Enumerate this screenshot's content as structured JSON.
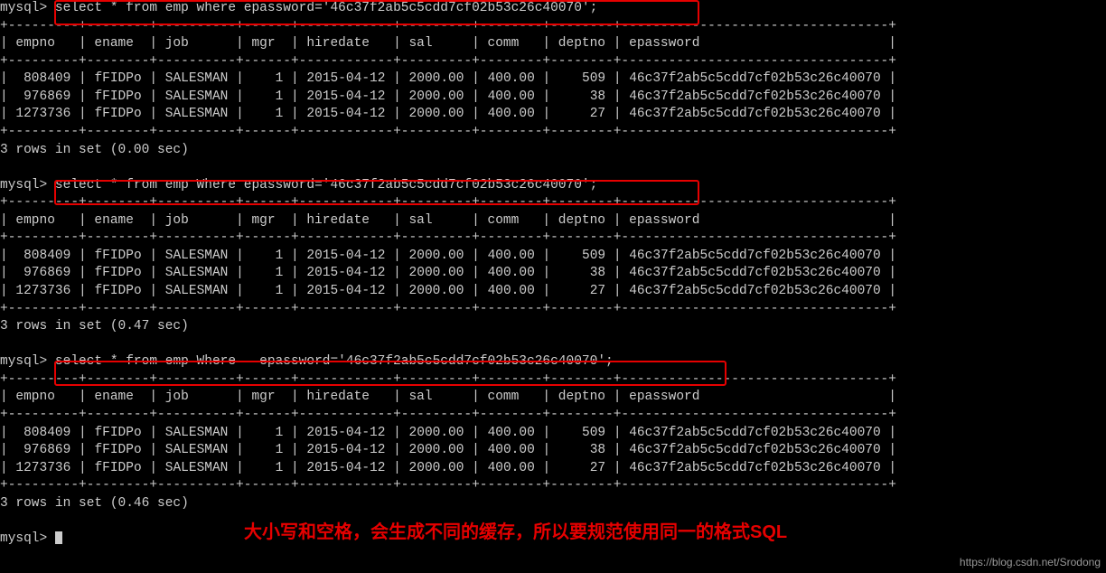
{
  "prompt": "mysql>",
  "queries": [
    "select * from emp where epassword='46c37f2ab5c5cdd7cf02b53c26c40070';",
    "select * from emp Where epassword='46c37f2ab5c5cdd7cf02b53c26c40070';",
    "select * from emp Where   epassword='46c37f2ab5c5cdd7cf02b53c26c40070';"
  ],
  "headers": [
    "empno",
    "ename",
    "job",
    "mgr",
    "hiredate",
    "sal",
    "comm",
    "deptno",
    "epassword"
  ],
  "rows": [
    {
      "empno": "808409",
      "ename": "fFIDPo",
      "job": "SALESMAN",
      "mgr": "1",
      "hiredate": "2015-04-12",
      "sal": "2000.00",
      "comm": "400.00",
      "deptno": "509",
      "epassword": "46c37f2ab5c5cdd7cf02b53c26c40070"
    },
    {
      "empno": "976869",
      "ename": "fFIDPo",
      "job": "SALESMAN",
      "mgr": "1",
      "hiredate": "2015-04-12",
      "sal": "2000.00",
      "comm": "400.00",
      "deptno": "38",
      "epassword": "46c37f2ab5c5cdd7cf02b53c26c40070"
    },
    {
      "empno": "1273736",
      "ename": "fFIDPo",
      "job": "SALESMAN",
      "mgr": "1",
      "hiredate": "2015-04-12",
      "sal": "2000.00",
      "comm": "400.00",
      "deptno": "27",
      "epassword": "46c37f2ab5c5cdd7cf02b53c26c40070"
    }
  ],
  "results": [
    "3 rows in set (0.00 sec)",
    "3 rows in set (0.47 sec)",
    "3 rows in set (0.46 sec)"
  ],
  "annotation": "大小写和空格，会生成不同的缓存，所以要规范使用同一的格式SQL",
  "watermark": "https://blog.csdn.net/Srodong",
  "border_top": "+---------+--------+----------+------+------------+---------+--------+--------+----------------------------------+",
  "header_line": "| empno   | ename  | job      | mgr  | hiredate   | sal     | comm   | deptno | epassword                        |"
}
